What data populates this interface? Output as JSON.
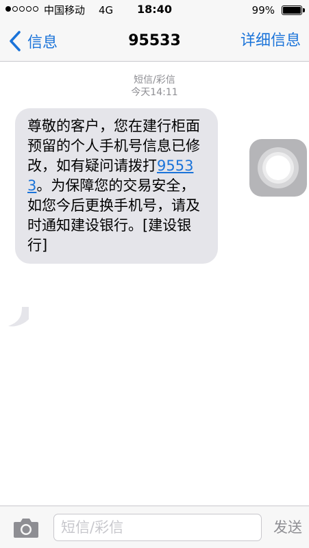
{
  "status_bar": {
    "carrier": "中国移动",
    "network": "4G",
    "time": "18:40",
    "battery_percent": "99%",
    "battery_level": 0.99,
    "signal_bars_filled": 1,
    "signal_bars_total": 5
  },
  "nav": {
    "back_label": "信息",
    "title": "95533",
    "details_label": "详细信息"
  },
  "conversation": {
    "message_type": "短信/彩信",
    "timestamp": "今天14:11",
    "message": {
      "text_before": "尊敬的客户，您在建行柜面预留的个人手机号信息已修改，如有疑问请拨打",
      "phone_link": "95533",
      "text_after": "。为保障您的交易安全，如您今后更换手机号，请及时通知建设银行。[建设银行]"
    }
  },
  "input_bar": {
    "placeholder": "短信/彩信",
    "send_label": "发送"
  },
  "colors": {
    "accent": "#1a73d9",
    "bubble": "#e5e5ea",
    "bar_background": "#f7f7f7",
    "secondary_text": "#8e8e93"
  }
}
